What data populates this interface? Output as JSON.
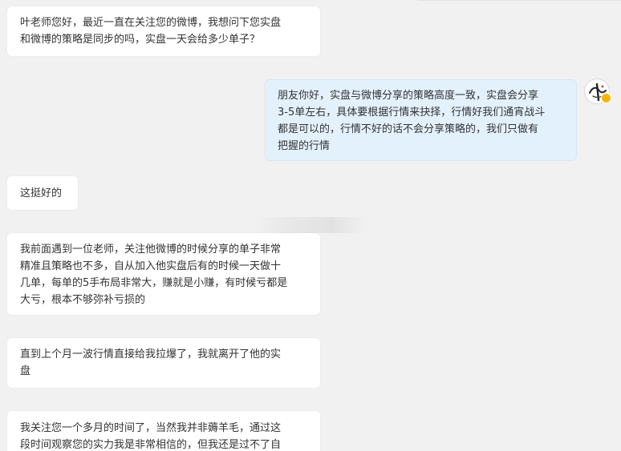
{
  "conversation": {
    "messages": [
      {
        "sender": "visitor",
        "lines": [
          "叶老师您好，最近一直在关注您的微博，我想问下您实盘",
          "和微博的策略是同步的吗，实盘一天会给多少单子？"
        ]
      },
      {
        "sender": "teacher",
        "lines": [
          "朋友你好，实盘与微博分享的策略高度一致，实盘会分享",
          "3-5单左右，具体要根据行情来抉择，行情好我们通宵战斗",
          "都是可以的，行情不好的话不会分享策略的，我们只做有",
          "把握的行情"
        ]
      },
      {
        "sender": "visitor",
        "lines": [
          "这挺好的"
        ]
      },
      {
        "sender": "visitor",
        "lines": [
          "我前面遇到一位老师，关注他微博的时候分享的单子非常",
          "精准且策略也不多，自从加入他实盘后有的时候一天做十",
          "几单，每单的5手布局非常大，赚就是小赚，有时候亏都是",
          "大亏，根本不够弥补亏损的"
        ]
      },
      {
        "sender": "visitor",
        "lines": [
          "直到上个月一波行情直接给我拉爆了，我就离开了他的实",
          "盘"
        ]
      },
      {
        "sender": "visitor",
        "lines": [
          "我关注您一个多月的时间了，当然我并非薅羊毛，通过这",
          "段时间观察您的实力我是非常相信的，但我还是过不了自"
        ]
      }
    ]
  },
  "avatar": {
    "icon": "ye-calligraphy-avatar-icon",
    "badge_icon": "verified-badge-icon",
    "badge_color": "#f7b500"
  },
  "colors": {
    "background": "#f1f1f1",
    "incoming_bubble": "#ffffff",
    "outgoing_bubble": "#e3f1fd",
    "text": "#333333"
  }
}
